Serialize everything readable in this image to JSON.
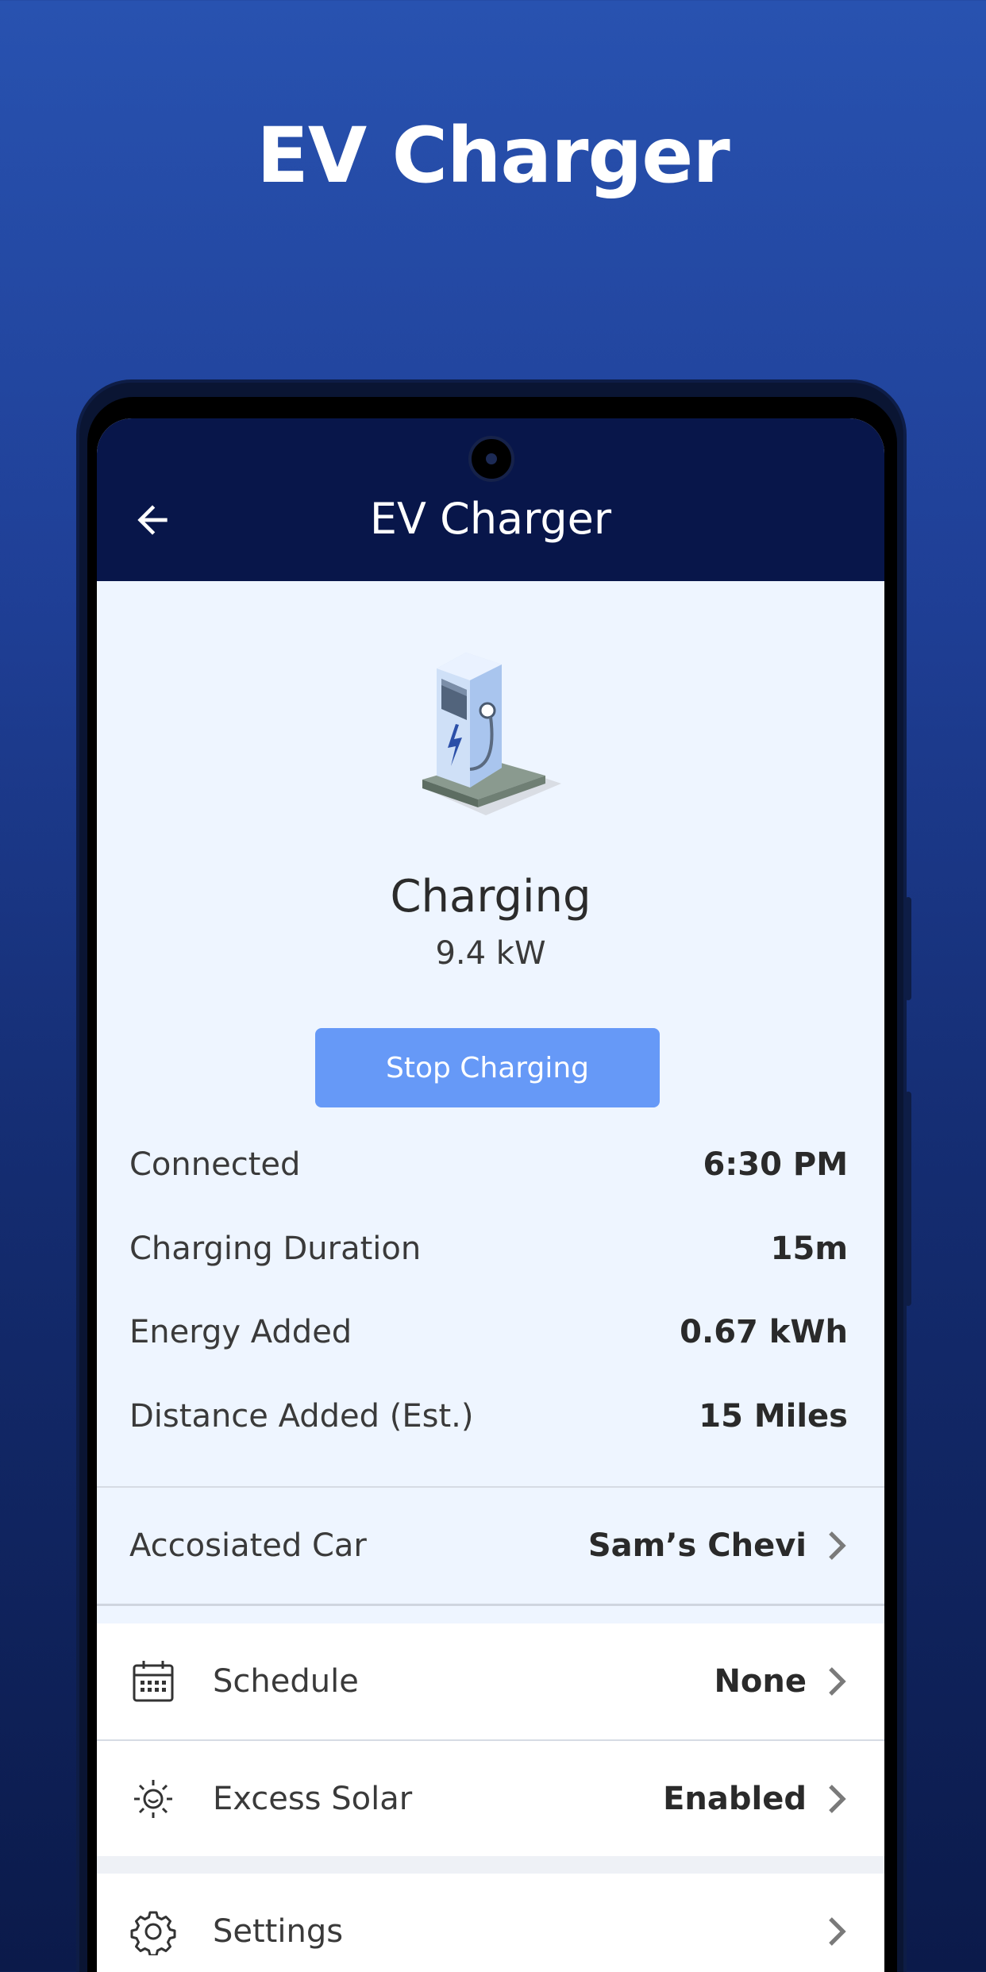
{
  "promo": {
    "title": "EV Charger"
  },
  "app_bar": {
    "title": "EV Charger"
  },
  "status": {
    "title": "Charging",
    "power": "9.4 kW"
  },
  "actions": {
    "stop_label": "Stop Charging"
  },
  "stats": [
    {
      "label": "Connected",
      "value": "6:30 PM"
    },
    {
      "label": "Charging Duration",
      "value": "15m"
    },
    {
      "label": "Energy Added",
      "value": "0.67 kWh"
    },
    {
      "label": "Distance Added (Est.)",
      "value": "15 Miles"
    }
  ],
  "car": {
    "label": "Accosiated Car",
    "value": "Sam’s Chevi"
  },
  "menu": [
    {
      "label": "Schedule",
      "value": "None",
      "icon": "calendar-icon"
    },
    {
      "label": "Excess Solar",
      "value": "Enabled",
      "icon": "sun-icon"
    },
    {
      "label": "Settings",
      "value": "",
      "icon": "gear-icon"
    }
  ],
  "colors": {
    "accent": "#6699f7",
    "app_bar": "#08164a",
    "screen_bg": "#eef5ff"
  }
}
